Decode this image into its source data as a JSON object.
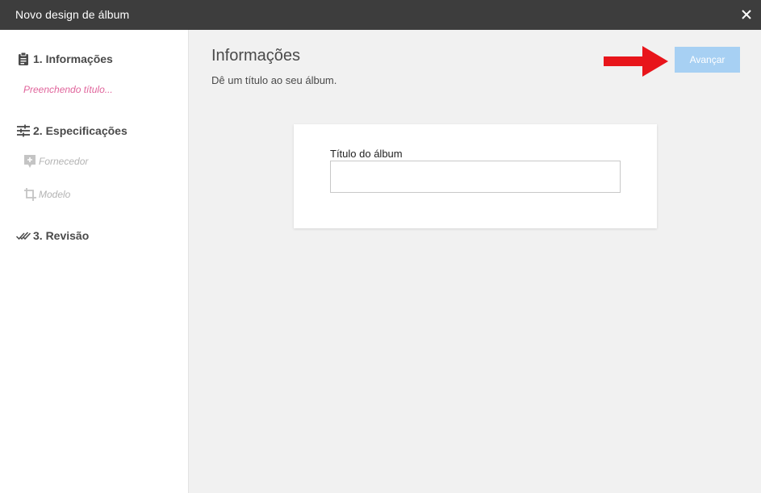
{
  "window": {
    "title": "Novo design de álbum"
  },
  "sidebar": {
    "steps": [
      {
        "label": "1. Informações",
        "icon": "clipboard-icon"
      },
      {
        "label": "2. Especificações",
        "icon": "sliders-icon"
      },
      {
        "label": "3. Revisão",
        "icon": "double-check-icon"
      }
    ],
    "status_text": "Preenchendo título...",
    "sub_steps": [
      {
        "label": "Fornecedor",
        "icon": "vendor-tag-icon"
      },
      {
        "label": "Modelo",
        "icon": "crop-icon"
      }
    ]
  },
  "main": {
    "title": "Informações",
    "subtitle": "Dê um título ao seu álbum.",
    "next_button": "Avançar",
    "album_title_label": "Título do álbum",
    "album_title_value": "",
    "album_title_placeholder": ""
  },
  "colors": {
    "titlebar": "#3d3d3d",
    "status_pink": "#e0649b",
    "button_disabled_blue": "#a7d0f3",
    "annotation_arrow_red": "#e8151b"
  }
}
